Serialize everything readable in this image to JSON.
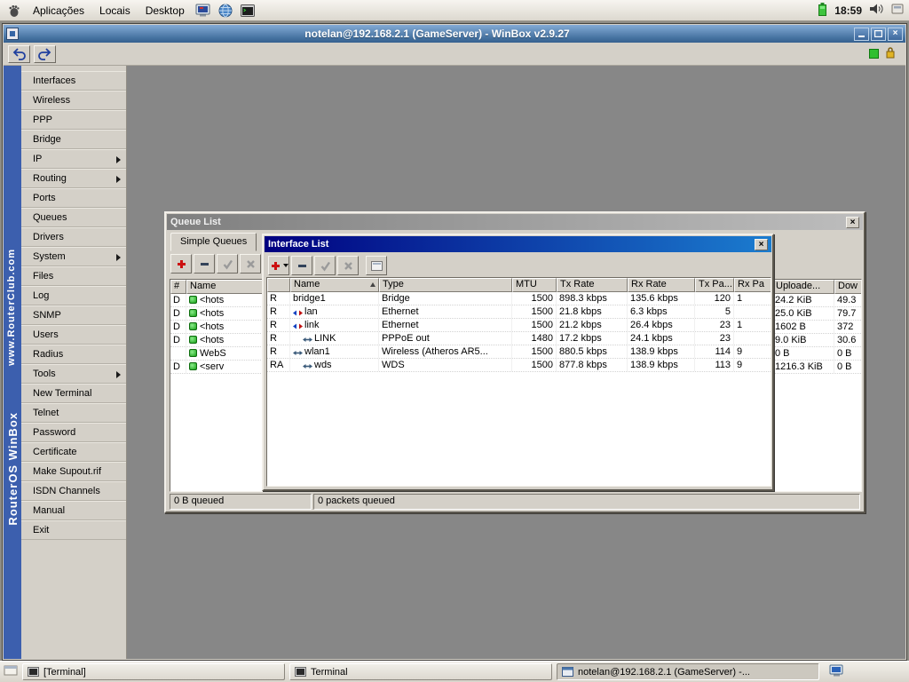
{
  "panel": {
    "menus": [
      "Aplicações",
      "Locais",
      "Desktop"
    ],
    "clock": "18:59"
  },
  "window": {
    "title": "notelan@192.168.2.1 (GameServer) - WinBox v2.9.27",
    "brand_name": "RouterOS WinBox",
    "brand_site": "www.RouterClub.com"
  },
  "sidebar": {
    "items": [
      {
        "label": "Interfaces"
      },
      {
        "label": "Wireless"
      },
      {
        "label": "PPP"
      },
      {
        "label": "Bridge"
      },
      {
        "label": "IP"
      },
      {
        "label": "Routing"
      },
      {
        "label": "Ports"
      },
      {
        "label": "Queues"
      },
      {
        "label": "Drivers"
      },
      {
        "label": "System"
      },
      {
        "label": "Files"
      },
      {
        "label": "Log"
      },
      {
        "label": "SNMP"
      },
      {
        "label": "Users"
      },
      {
        "label": "Radius"
      },
      {
        "label": "Tools"
      },
      {
        "label": "New Terminal"
      },
      {
        "label": "Telnet"
      },
      {
        "label": "Password"
      },
      {
        "label": "Certificate"
      },
      {
        "label": "Make Supout.rif"
      },
      {
        "label": "ISDN Channels"
      },
      {
        "label": "Manual"
      },
      {
        "label": "Exit"
      }
    ]
  },
  "queue_list": {
    "title": "Queue List",
    "tab_label": "Simple Queues",
    "columns": {
      "hash": "#",
      "name": "Name",
      "uploaded": "Uploade...",
      "down": "Dow"
    },
    "rows": [
      {
        "flag": "D",
        "name": "<hots",
        "uploaded": "24.2 KiB",
        "down": "49.3"
      },
      {
        "flag": "D",
        "name": "<hots",
        "uploaded": "25.0 KiB",
        "down": "79.7"
      },
      {
        "flag": "D",
        "name": "<hots",
        "uploaded": "1602 B",
        "down": "372"
      },
      {
        "flag": "D",
        "name": "<hots",
        "uploaded": "9.0 KiB",
        "down": "30.6"
      },
      {
        "flag": "",
        "name": "WebS",
        "uploaded": "0 B",
        "down": "0 B"
      },
      {
        "flag": "D",
        "name": "<serv",
        "uploaded": "1216.3 KiB",
        "down": "0 B"
      }
    ],
    "status_bytes": "0 B queued",
    "status_packets": "0 packets queued"
  },
  "interface_list": {
    "title": "Interface List",
    "columns": {
      "name": "Name",
      "type": "Type",
      "mtu": "MTU",
      "tx": "Tx Rate",
      "rx": "Rx Rate",
      "txp": "Tx Pa...",
      "rxp": "Rx Pa"
    },
    "rows": [
      {
        "flags": "R",
        "name": "bridge1",
        "type": "Bridge",
        "mtu": "1500",
        "tx": "898.3 kbps",
        "rx": "135.6 kbps",
        "txp": "120",
        "rxp": "1"
      },
      {
        "flags": "R",
        "name": "lan",
        "type": "Ethernet",
        "mtu": "1500",
        "tx": "21.8 kbps",
        "rx": "6.3 kbps",
        "txp": "5",
        "rxp": ""
      },
      {
        "flags": "R",
        "name": "link",
        "type": "Ethernet",
        "mtu": "1500",
        "tx": "21.2 kbps",
        "rx": "26.4 kbps",
        "txp": "23",
        "rxp": "1"
      },
      {
        "flags": "R",
        "name": "LINK",
        "type": "PPPoE out",
        "mtu": "1480",
        "tx": "17.2 kbps",
        "rx": "24.1 kbps",
        "txp": "23",
        "rxp": ""
      },
      {
        "flags": "R",
        "name": "wlan1",
        "type": "Wireless (Atheros AR5...",
        "mtu": "1500",
        "tx": "880.5 kbps",
        "rx": "138.9 kbps",
        "txp": "114",
        "rxp": "9"
      },
      {
        "flags": "RA",
        "name": "wds",
        "type": "WDS",
        "mtu": "1500",
        "tx": "877.8 kbps",
        "rx": "138.9 kbps",
        "txp": "113",
        "rxp": "9"
      }
    ]
  },
  "taskbar": {
    "items": [
      "[Terminal]",
      "Terminal",
      "notelan@192.168.2.1 (GameServer) -..."
    ]
  },
  "colors": {
    "titlebar_active": "#44719f",
    "child_title_active_from": "#000080",
    "child_title_active_to": "#1b7ccf",
    "child_title_inactive": "#9a9a9a",
    "brand_strip": "#3c5fae",
    "add_button_red": "#cc1111",
    "status_green": "#2fbf2f",
    "lock_yellow": "#d8a820",
    "workspace_gray": "#878787"
  },
  "icons": {
    "panel_logo": "gnome-foot-icon",
    "launchers": [
      "monitor-icon",
      "globe-icon",
      "terminal-icon"
    ],
    "panel_tray": [
      "battery-icon",
      "volume-icon",
      "applet-icon"
    ],
    "window_controls": [
      "minimize-icon",
      "maximize-icon",
      "close-icon"
    ],
    "main_toolbar": [
      "undo-icon",
      "redo-icon",
      "connected-indicator",
      "secure-lock-icon"
    ],
    "list_toolbar": [
      "add-icon",
      "remove-icon",
      "enable-icon",
      "disable-icon",
      "details-icon"
    ],
    "row_icons": [
      "queue-icon",
      "ethernet-icon",
      "link-icon"
    ]
  }
}
